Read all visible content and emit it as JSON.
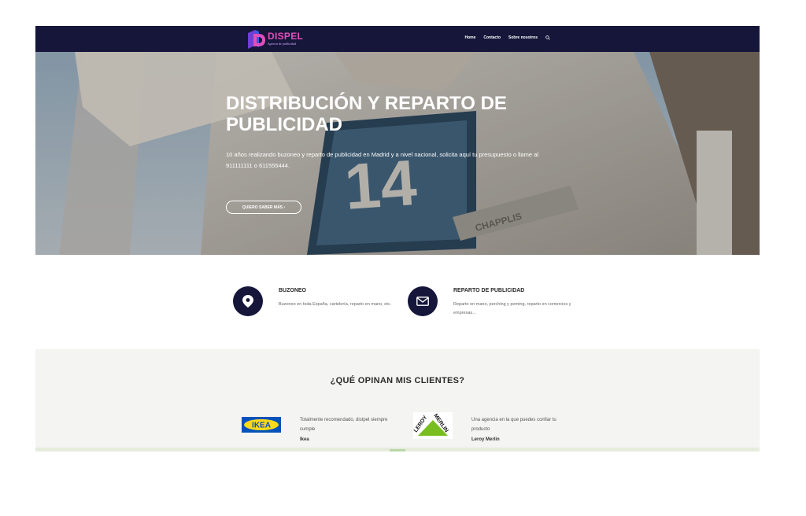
{
  "header": {
    "logo_text": "DISPEL",
    "logo_tagline": "Agencia de publicidad",
    "nav": [
      "Home",
      "Contacto",
      "Sobre nosotros"
    ]
  },
  "hero": {
    "title": "DISTRIBUCIÓN Y REPARTO DE PUBLICIDAD",
    "text": "10 años realizando buzoneo y reparto de publicidad en Madrid y a nivel nacional, solicita aquí tu presupuesto o llame al 911111111 o 611555444.",
    "button_label": "QUIERO SABER MÁS ›",
    "image_number": "14",
    "image_brand": "CHAPPLIS"
  },
  "services": [
    {
      "title": "BUZONEO",
      "description": "Buzoneo en toda España, cartelería, reparto en mano, etc.",
      "icon": "map-pin-icon"
    },
    {
      "title": "REPARTO DE PUBLICIDAD",
      "description": "Reparto en mano, perching y poming, reparto en comercios y empresas…",
      "icon": "envelope-icon"
    }
  ],
  "testimonials": {
    "title": "¿QUÉ OPINAN MIS CLIENTES?",
    "items": [
      {
        "quote": "Totalmente recomendado, distpel siempre cumple",
        "author": "Ikea",
        "logo_text": "IKEA"
      },
      {
        "quote": "Una agencia en la que puedes confiar tu producto",
        "author": "Leroy Merlin",
        "logo_text_1": "LEROY",
        "logo_text_2": "MERLIN"
      }
    ]
  },
  "colors": {
    "header_bg": "#15163a",
    "accent_pink": "#e04fb8",
    "icon_circle": "#15163a",
    "section_bg": "#f4f4f2",
    "ikea_blue": "#0051ba",
    "ikea_yellow": "#ffda1a",
    "leroy_green": "#78be20"
  }
}
